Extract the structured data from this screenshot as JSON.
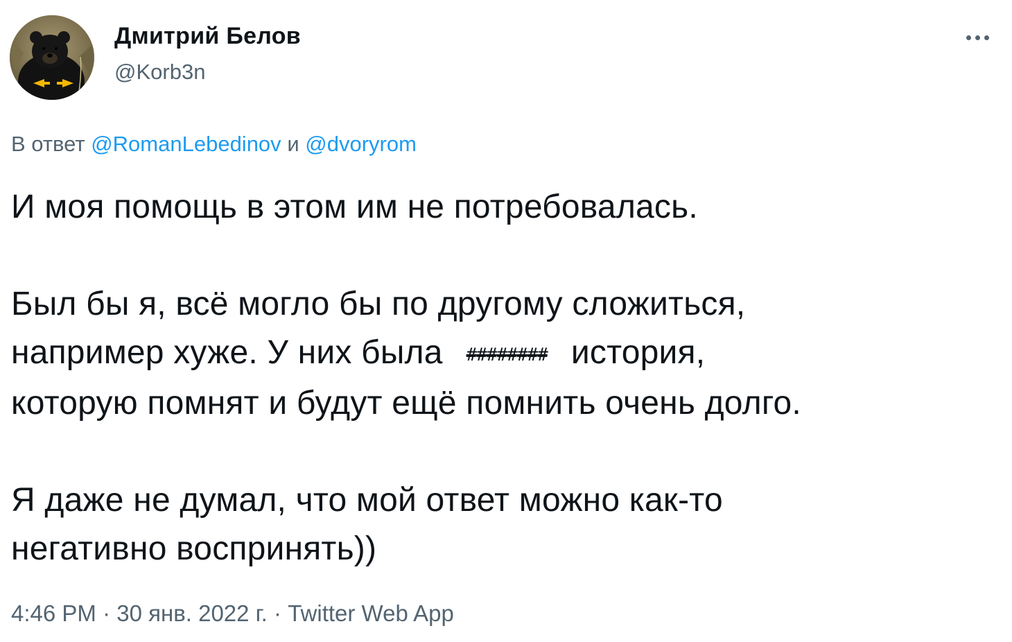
{
  "author": {
    "display_name": "Дмитрий Белов",
    "handle": "@Korb3n"
  },
  "more_icon": "more-horizontal-icon",
  "reply_context": {
    "prefix": "В ответ",
    "mention_1": "@RomanLebedinov",
    "conjunction": "и",
    "mention_2": "@dvoryrom"
  },
  "tweet": {
    "paragraph_1": "И моя помощь в этом им не потребовалась.",
    "paragraph_2_line_1": "Был бы я, всё могло бы по другому сложиться,",
    "paragraph_2_line_2_start": "например хуже. У них была",
    "redacted_word": "########",
    "paragraph_2_line_2_end": "история,",
    "paragraph_2_line_3": "которую помнят и будут ещё помнить очень долго.",
    "paragraph_3": "Я даже не думал, что мой ответ можно как-то негативно воспринять))"
  },
  "meta": {
    "time": "4:46 PM",
    "separator": "·",
    "date": "30 янв. 2022 г.",
    "source": "Twitter Web App"
  },
  "colors": {
    "text": "#0f1419",
    "secondary": "#536471",
    "link": "#1d9bf0"
  }
}
